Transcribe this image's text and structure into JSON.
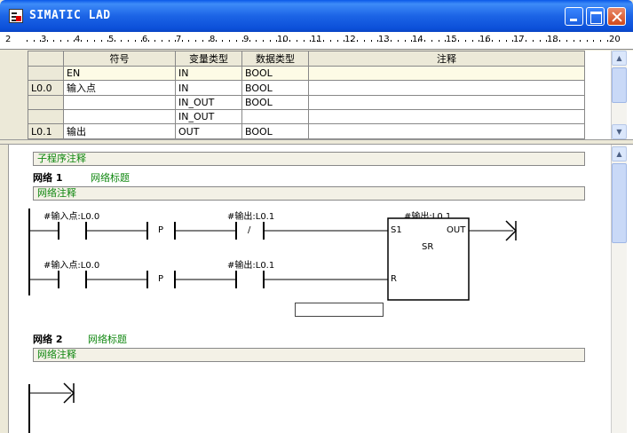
{
  "window": {
    "title": "SIMATIC LAD"
  },
  "ruler": {
    "numbers": [
      "2",
      "3",
      "4",
      "5",
      "6",
      "7",
      "8",
      "9",
      "10",
      "11",
      "12",
      "13",
      "14",
      "15",
      "16",
      "17",
      "18",
      "20"
    ]
  },
  "interface_table": {
    "headers": [
      "符号",
      "变量类型",
      "数据类型",
      "注释"
    ],
    "rows": [
      {
        "address": "",
        "symbol": "EN",
        "var_type": "IN",
        "data_type": "BOOL",
        "comment": ""
      },
      {
        "address": "L0.0",
        "symbol": "输入点",
        "var_type": "IN",
        "data_type": "BOOL",
        "comment": ""
      },
      {
        "address": "",
        "symbol": "",
        "var_type": "IN_OUT",
        "data_type": "BOOL",
        "comment": ""
      },
      {
        "address": "",
        "symbol": "",
        "var_type": "IN_OUT",
        "data_type": "",
        "comment": ""
      },
      {
        "address": "L0.1",
        "symbol": "输出",
        "var_type": "OUT",
        "data_type": "BOOL",
        "comment": ""
      }
    ]
  },
  "editor": {
    "subroutine_comment": "子程序注释",
    "network1": {
      "label": "网络 1",
      "title": "网络标题",
      "comment": "网络注释",
      "rung1_input": "#输入点:L0.0",
      "rung1_output_contact": "#输出:L0.1",
      "rung2_input": "#输入点:L0.0",
      "rung2_output_contact": "#输出:L0.1",
      "p_symbol": "P",
      "nc_symbol": "/",
      "sr": {
        "operand": "#输出:L0.1",
        "s1": "S1",
        "out": "OUT",
        "name": "SR",
        "r": "R"
      }
    },
    "network2": {
      "label": "网络 2",
      "title": "网络标题",
      "comment": "网络注释"
    }
  }
}
